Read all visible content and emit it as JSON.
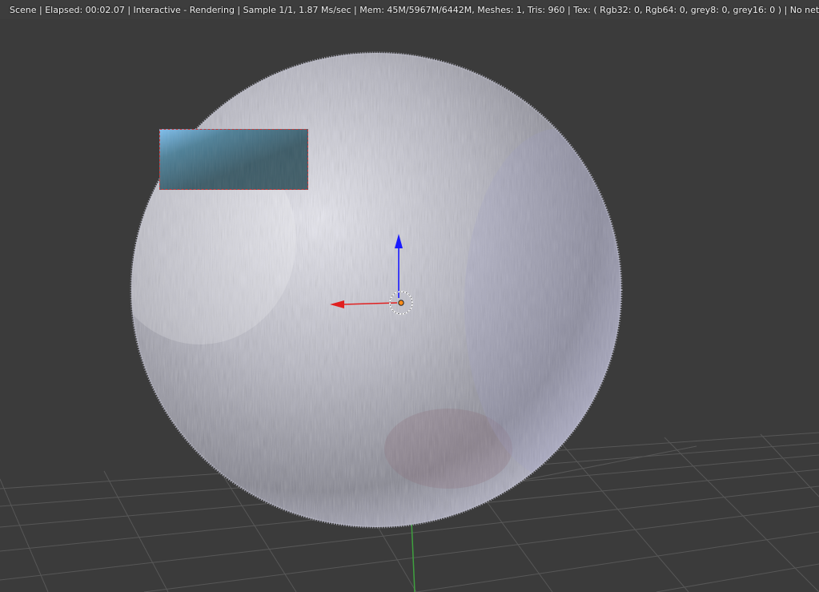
{
  "window": {
    "render_stats": "Scene | Elapsed: 00:02.07 | Interactive - Rendering | Sample 1/1, 1.87 Ms/sec | Mem: 45M/5967M/6442M, Meshes: 1, Tris: 960 | Tex: ( Rgb32: 0, Rgb64: 0, grey8: 0, grey16: 0 ) | No net GPUs"
  },
  "colors": {
    "viewport_bg": "#3b3b3b",
    "grid_line": "#565656",
    "x_axis": "#e02020",
    "z_axis": "#1a1aff",
    "y_axis_line": "#3fa03f",
    "origin_fill": "#ff8c1a",
    "border_region": "#cc3b3b",
    "sphere_light": "#e4e4ec",
    "sphere_mid": "#a8a8b4",
    "sphere_dark": "#6e6e78"
  },
  "icons": {
    "pivot": "cursor-ring-icon",
    "manipulator": "transform-arrows-icon"
  }
}
